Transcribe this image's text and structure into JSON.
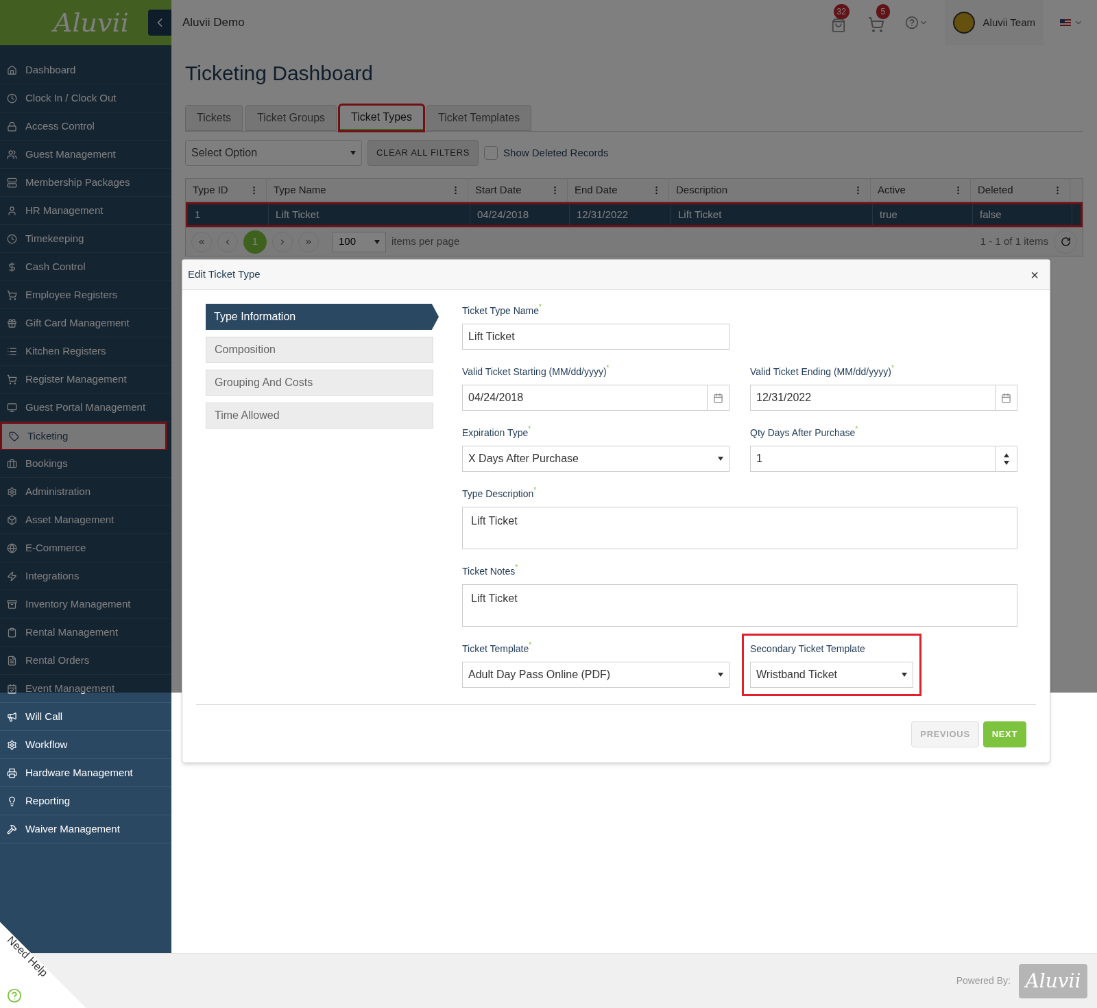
{
  "header": {
    "logo": "Aluvii",
    "title": "Aluvii Demo",
    "bag_badge": "32",
    "cart_badge": "5",
    "user_name": "Aluvii Team"
  },
  "sidebar": {
    "items": [
      {
        "label": "Dashboard",
        "selected": false,
        "highlighted": false
      },
      {
        "label": "Clock In / Clock Out",
        "selected": false,
        "highlighted": false
      },
      {
        "label": "Access Control",
        "selected": false,
        "highlighted": false
      },
      {
        "label": "Guest Management",
        "selected": false,
        "highlighted": false
      },
      {
        "label": "Membership Packages",
        "selected": false,
        "highlighted": false
      },
      {
        "label": "HR Management",
        "selected": false,
        "highlighted": false
      },
      {
        "label": "Timekeeping",
        "selected": false,
        "highlighted": false
      },
      {
        "label": "Cash Control",
        "selected": false,
        "highlighted": false
      },
      {
        "label": "Employee Registers",
        "selected": false,
        "highlighted": false
      },
      {
        "label": "Gift Card Management",
        "selected": false,
        "highlighted": false
      },
      {
        "label": "Kitchen Registers",
        "selected": false,
        "highlighted": false
      },
      {
        "label": "Register Management",
        "selected": false,
        "highlighted": false
      },
      {
        "label": "Guest Portal Management",
        "selected": false,
        "highlighted": false
      },
      {
        "label": "Ticketing",
        "selected": true,
        "highlighted": true
      },
      {
        "label": "Bookings",
        "selected": false,
        "highlighted": false
      },
      {
        "label": "Administration",
        "selected": false,
        "highlighted": false
      },
      {
        "label": "Asset Management",
        "selected": false,
        "highlighted": false
      },
      {
        "label": "E-Commerce",
        "selected": false,
        "highlighted": false
      },
      {
        "label": "Integrations",
        "selected": false,
        "highlighted": false
      },
      {
        "label": "Inventory Management",
        "selected": false,
        "highlighted": false
      },
      {
        "label": "Rental Management",
        "selected": false,
        "highlighted": false
      },
      {
        "label": "Rental Orders",
        "selected": false,
        "highlighted": false
      },
      {
        "label": "Event Management",
        "selected": false,
        "highlighted": false
      },
      {
        "label": "Will Call",
        "selected": false,
        "highlighted": false
      },
      {
        "label": "Workflow",
        "selected": false,
        "highlighted": false
      },
      {
        "label": "Hardware Management",
        "selected": false,
        "highlighted": false
      },
      {
        "label": "Reporting",
        "selected": false,
        "highlighted": false
      },
      {
        "label": "Waiver Management",
        "selected": false,
        "highlighted": false
      }
    ]
  },
  "page": {
    "title": "Ticketing Dashboard",
    "tabs": [
      {
        "label": "Tickets",
        "selected": false,
        "highlighted": false
      },
      {
        "label": "Ticket Groups",
        "selected": false,
        "highlighted": false
      },
      {
        "label": "Ticket Types",
        "selected": true,
        "highlighted": true
      },
      {
        "label": "Ticket Templates",
        "selected": false,
        "highlighted": false
      }
    ],
    "filter_select": "Select Option",
    "clear_button": "CLEAR ALL FILTERS",
    "show_deleted": {
      "label": "Show Deleted Records",
      "checked": false
    }
  },
  "table": {
    "columns": [
      "Type ID",
      "Type Name",
      "Start Date",
      "End Date",
      "Description",
      "Active",
      "Deleted"
    ],
    "rows": [
      {
        "cells": [
          "1",
          "Lift Ticket",
          "04/24/2018",
          "12/31/2022",
          "Lift Ticket",
          "true",
          "false"
        ],
        "selected": true,
        "highlighted": true
      }
    ],
    "pager": {
      "current_page": "1",
      "page_size": "100",
      "page_size_label": "items per page",
      "summary": "1 - 1 of 1 items"
    }
  },
  "modal": {
    "title": "Edit Ticket Type",
    "close": "×",
    "steps": [
      {
        "label": "Type Information",
        "selected": true
      },
      {
        "label": "Composition",
        "selected": false
      },
      {
        "label": "Grouping And Costs",
        "selected": false
      },
      {
        "label": "Time Allowed",
        "selected": false
      }
    ],
    "rows": [
      [
        {
          "kind": "text",
          "label": "Ticket Type Name",
          "required_mark": "*",
          "value": "Lift Ticket",
          "highlighted": false
        }
      ],
      [
        {
          "kind": "date",
          "label": "Valid Ticket Starting (MM/dd/yyyy)",
          "required_mark": "*",
          "value": "04/24/2018",
          "highlighted": false
        },
        {
          "kind": "date",
          "label": "Valid Ticket Ending (MM/dd/yyyy)",
          "required_mark": "*",
          "value": "12/31/2022",
          "highlighted": false
        }
      ],
      [
        {
          "kind": "select",
          "label": "Expiration Type",
          "required_mark": "*",
          "value": "X Days After Purchase",
          "highlighted": false
        },
        {
          "kind": "number",
          "label": "Qty Days After Purchase",
          "required_mark": "*",
          "value": "1",
          "highlighted": false
        }
      ],
      [
        {
          "kind": "textarea",
          "label": "Type Description",
          "required_mark": "*",
          "value": "Lift Ticket",
          "highlighted": false
        }
      ],
      [
        {
          "kind": "textarea",
          "label": "Ticket Notes",
          "required_mark": "*",
          "value": "Lift Ticket",
          "highlighted": false
        }
      ],
      [
        {
          "kind": "select",
          "label": "Ticket Template",
          "required_mark": "*",
          "value": "Adult Day Pass Online (PDF)",
          "highlighted": false
        },
        {
          "kind": "select",
          "label": "Secondary Ticket Template",
          "value": "Wristband Ticket",
          "highlighted": true
        }
      ]
    ],
    "buttons": [
      {
        "label": "PREVIOUS",
        "disabled": true
      },
      {
        "label": "NEXT",
        "disabled": false
      }
    ]
  },
  "help_label": "Need Help",
  "footer": {
    "powered_by": "Powered By:",
    "logo": "Aluvii"
  }
}
